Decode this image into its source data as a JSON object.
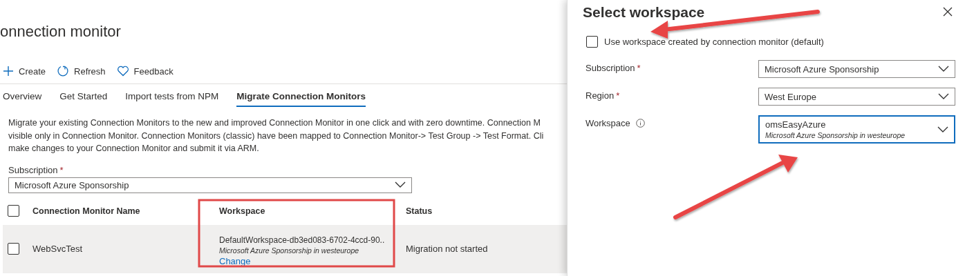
{
  "page_title": "onnection monitor",
  "toolbar": [
    {
      "kind": "plus",
      "label": "Create"
    },
    {
      "kind": "refresh",
      "label": "Refresh"
    },
    {
      "kind": "heart",
      "label": "Feedback"
    }
  ],
  "tabs": [
    {
      "label": "Overview",
      "selected": false
    },
    {
      "label": "Get Started",
      "selected": false
    },
    {
      "label": "Import tests from NPM",
      "selected": false
    },
    {
      "label": "Migrate Connection Monitors",
      "selected": true
    }
  ],
  "description_lines": [
    "Migrate your existing Connection Monitors to the new and improved Connection Monitor in one click and with zero downtime. Connection M",
    "visible only in Connection Monitor. Connection Monitors (classic) have been mapped to Connection Monitor-> Test Group -> Test Format. Cli",
    "make changes to your Connection Monitor and submit it via ARM."
  ],
  "subscription": {
    "label": "Subscription",
    "required_mark": "*",
    "value": "Microsoft Azure Sponsorship"
  },
  "table": {
    "select_all_checked": false,
    "columns": [
      "Connection Monitor Name",
      "Workspace",
      "Status"
    ],
    "rows": [
      {
        "checked": false,
        "name": "WebSvcTest",
        "workspace": "DefaultWorkspace-db3ed083-6702-4ccd-90..",
        "workspace_detail": "Microsoft Azure Sponsorship in westeurope",
        "action": "Change",
        "status": "Migration not started"
      }
    ]
  },
  "panel": {
    "title": "Select workspace",
    "default_checkbox": {
      "label": "Use workspace created by connection monitor (default)",
      "checked": false
    },
    "fields": [
      {
        "label": "Subscription",
        "required_mark": "*",
        "value": "Microsoft Azure Sponsorship",
        "focused": false
      },
      {
        "label": "Region",
        "required_mark": "*",
        "value": "West Europe",
        "focused": false
      },
      {
        "label": "Workspace",
        "info": true,
        "value": "omsEasyAzure",
        "detail": "Microsoft Azure Sponsorship in westeurope",
        "focused": true
      }
    ]
  }
}
